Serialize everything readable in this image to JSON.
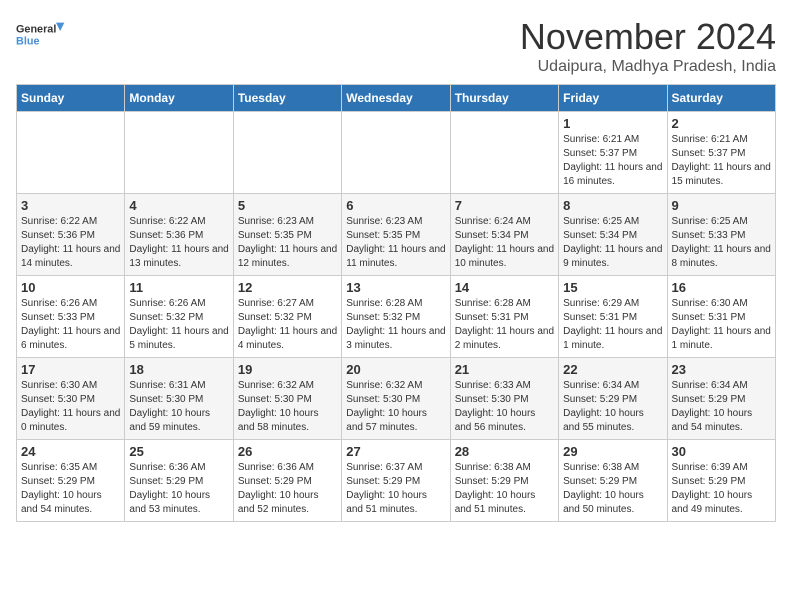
{
  "header": {
    "logo_general": "General",
    "logo_blue": "Blue",
    "month_title": "November 2024",
    "location": "Udaipura, Madhya Pradesh, India"
  },
  "weekdays": [
    "Sunday",
    "Monday",
    "Tuesday",
    "Wednesday",
    "Thursday",
    "Friday",
    "Saturday"
  ],
  "weeks": [
    [
      {
        "day": "",
        "info": ""
      },
      {
        "day": "",
        "info": ""
      },
      {
        "day": "",
        "info": ""
      },
      {
        "day": "",
        "info": ""
      },
      {
        "day": "",
        "info": ""
      },
      {
        "day": "1",
        "info": "Sunrise: 6:21 AM\nSunset: 5:37 PM\nDaylight: 11 hours and 16 minutes."
      },
      {
        "day": "2",
        "info": "Sunrise: 6:21 AM\nSunset: 5:37 PM\nDaylight: 11 hours and 15 minutes."
      }
    ],
    [
      {
        "day": "3",
        "info": "Sunrise: 6:22 AM\nSunset: 5:36 PM\nDaylight: 11 hours and 14 minutes."
      },
      {
        "day": "4",
        "info": "Sunrise: 6:22 AM\nSunset: 5:36 PM\nDaylight: 11 hours and 13 minutes."
      },
      {
        "day": "5",
        "info": "Sunrise: 6:23 AM\nSunset: 5:35 PM\nDaylight: 11 hours and 12 minutes."
      },
      {
        "day": "6",
        "info": "Sunrise: 6:23 AM\nSunset: 5:35 PM\nDaylight: 11 hours and 11 minutes."
      },
      {
        "day": "7",
        "info": "Sunrise: 6:24 AM\nSunset: 5:34 PM\nDaylight: 11 hours and 10 minutes."
      },
      {
        "day": "8",
        "info": "Sunrise: 6:25 AM\nSunset: 5:34 PM\nDaylight: 11 hours and 9 minutes."
      },
      {
        "day": "9",
        "info": "Sunrise: 6:25 AM\nSunset: 5:33 PM\nDaylight: 11 hours and 8 minutes."
      }
    ],
    [
      {
        "day": "10",
        "info": "Sunrise: 6:26 AM\nSunset: 5:33 PM\nDaylight: 11 hours and 6 minutes."
      },
      {
        "day": "11",
        "info": "Sunrise: 6:26 AM\nSunset: 5:32 PM\nDaylight: 11 hours and 5 minutes."
      },
      {
        "day": "12",
        "info": "Sunrise: 6:27 AM\nSunset: 5:32 PM\nDaylight: 11 hours and 4 minutes."
      },
      {
        "day": "13",
        "info": "Sunrise: 6:28 AM\nSunset: 5:32 PM\nDaylight: 11 hours and 3 minutes."
      },
      {
        "day": "14",
        "info": "Sunrise: 6:28 AM\nSunset: 5:31 PM\nDaylight: 11 hours and 2 minutes."
      },
      {
        "day": "15",
        "info": "Sunrise: 6:29 AM\nSunset: 5:31 PM\nDaylight: 11 hours and 1 minute."
      },
      {
        "day": "16",
        "info": "Sunrise: 6:30 AM\nSunset: 5:31 PM\nDaylight: 11 hours and 1 minute."
      }
    ],
    [
      {
        "day": "17",
        "info": "Sunrise: 6:30 AM\nSunset: 5:30 PM\nDaylight: 11 hours and 0 minutes."
      },
      {
        "day": "18",
        "info": "Sunrise: 6:31 AM\nSunset: 5:30 PM\nDaylight: 10 hours and 59 minutes."
      },
      {
        "day": "19",
        "info": "Sunrise: 6:32 AM\nSunset: 5:30 PM\nDaylight: 10 hours and 58 minutes."
      },
      {
        "day": "20",
        "info": "Sunrise: 6:32 AM\nSunset: 5:30 PM\nDaylight: 10 hours and 57 minutes."
      },
      {
        "day": "21",
        "info": "Sunrise: 6:33 AM\nSunset: 5:30 PM\nDaylight: 10 hours and 56 minutes."
      },
      {
        "day": "22",
        "info": "Sunrise: 6:34 AM\nSunset: 5:29 PM\nDaylight: 10 hours and 55 minutes."
      },
      {
        "day": "23",
        "info": "Sunrise: 6:34 AM\nSunset: 5:29 PM\nDaylight: 10 hours and 54 minutes."
      }
    ],
    [
      {
        "day": "24",
        "info": "Sunrise: 6:35 AM\nSunset: 5:29 PM\nDaylight: 10 hours and 54 minutes."
      },
      {
        "day": "25",
        "info": "Sunrise: 6:36 AM\nSunset: 5:29 PM\nDaylight: 10 hours and 53 minutes."
      },
      {
        "day": "26",
        "info": "Sunrise: 6:36 AM\nSunset: 5:29 PM\nDaylight: 10 hours and 52 minutes."
      },
      {
        "day": "27",
        "info": "Sunrise: 6:37 AM\nSunset: 5:29 PM\nDaylight: 10 hours and 51 minutes."
      },
      {
        "day": "28",
        "info": "Sunrise: 6:38 AM\nSunset: 5:29 PM\nDaylight: 10 hours and 51 minutes."
      },
      {
        "day": "29",
        "info": "Sunrise: 6:38 AM\nSunset: 5:29 PM\nDaylight: 10 hours and 50 minutes."
      },
      {
        "day": "30",
        "info": "Sunrise: 6:39 AM\nSunset: 5:29 PM\nDaylight: 10 hours and 49 minutes."
      }
    ]
  ]
}
